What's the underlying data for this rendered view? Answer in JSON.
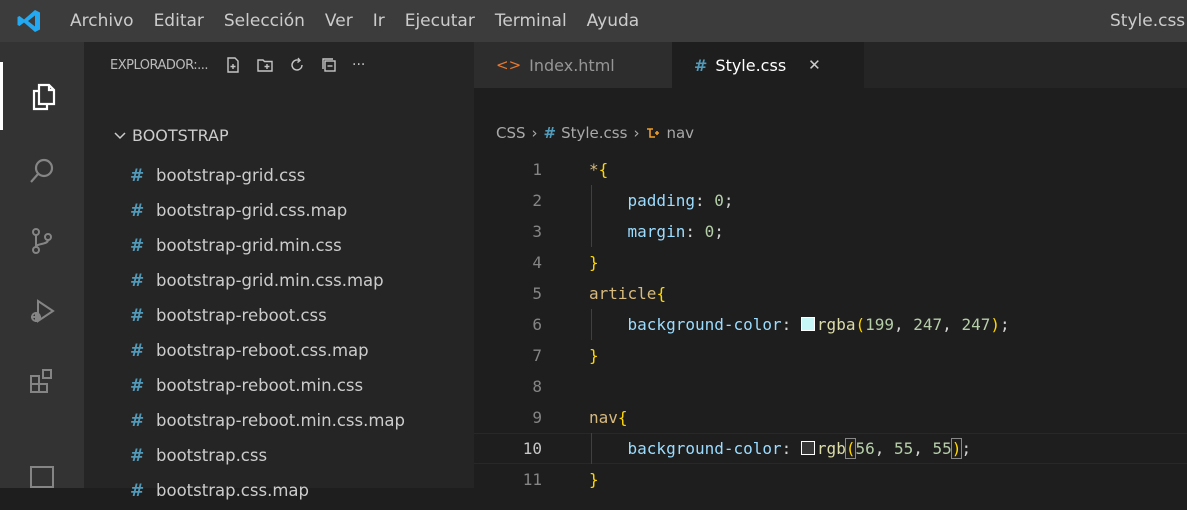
{
  "titlebar": {
    "menu": [
      "Archivo",
      "Editar",
      "Selección",
      "Ver",
      "Ir",
      "Ejecutar",
      "Terminal",
      "Ayuda"
    ],
    "window_title": "Style.css"
  },
  "sidebar": {
    "title": "EXPLORADOR:...",
    "folder": "BOOTSTRAP",
    "files": [
      "bootstrap-grid.css",
      "bootstrap-grid.css.map",
      "bootstrap-grid.min.css",
      "bootstrap-grid.min.css.map",
      "bootstrap-reboot.css",
      "bootstrap-reboot.css.map",
      "bootstrap-reboot.min.css",
      "bootstrap-reboot.min.css.map",
      "bootstrap.css",
      "bootstrap.css.map"
    ]
  },
  "tabs": [
    {
      "label": "Index.html",
      "icon": "html-file-icon",
      "active": false
    },
    {
      "label": "Style.css",
      "icon": "css-hash-icon",
      "active": true
    }
  ],
  "breadcrumb": [
    "CSS",
    "Style.css",
    "nav"
  ],
  "editor": {
    "current_line": 10,
    "lines": [
      {
        "n": "1",
        "tokens": [
          [
            "sel",
            "*"
          ],
          [
            "brace",
            "{"
          ]
        ]
      },
      {
        "n": "2",
        "tokens": [
          [
            "ws",
            "    "
          ],
          [
            "prop",
            "padding"
          ],
          [
            "punc",
            ": "
          ],
          [
            "num",
            "0"
          ],
          [
            "punc",
            ";"
          ]
        ]
      },
      {
        "n": "3",
        "tokens": [
          [
            "ws",
            "    "
          ],
          [
            "prop",
            "margin"
          ],
          [
            "punc",
            ": "
          ],
          [
            "num",
            "0"
          ],
          [
            "punc",
            ";"
          ]
        ]
      },
      {
        "n": "4",
        "tokens": [
          [
            "brace",
            "}"
          ]
        ]
      },
      {
        "n": "5",
        "tokens": [
          [
            "sel",
            "article"
          ],
          [
            "brace",
            "{"
          ]
        ]
      },
      {
        "n": "6",
        "tokens": [
          [
            "ws",
            "    "
          ],
          [
            "prop",
            "background-color"
          ],
          [
            "punc",
            ": "
          ],
          [
            "swatch",
            "#c7f7f7"
          ],
          [
            "fn",
            "rgba"
          ],
          [
            "brace",
            "("
          ],
          [
            "num",
            "199"
          ],
          [
            "punc",
            ", "
          ],
          [
            "num",
            "247"
          ],
          [
            "punc",
            ", "
          ],
          [
            "num",
            "247"
          ],
          [
            "brace",
            ")"
          ],
          [
            "punc",
            ";"
          ]
        ]
      },
      {
        "n": "7",
        "tokens": [
          [
            "brace",
            "}"
          ]
        ]
      },
      {
        "n": "8",
        "tokens": []
      },
      {
        "n": "9",
        "tokens": [
          [
            "sel",
            "nav"
          ],
          [
            "brace",
            "{"
          ]
        ]
      },
      {
        "n": "10",
        "tokens": [
          [
            "ws",
            "    "
          ],
          [
            "prop",
            "background-color"
          ],
          [
            "punc",
            ": "
          ],
          [
            "swatch",
            "#383737"
          ],
          [
            "fn",
            "rgb"
          ],
          [
            "bracketopen",
            "("
          ],
          [
            "num",
            "56"
          ],
          [
            "punc",
            ", "
          ],
          [
            "num",
            "55"
          ],
          [
            "punc",
            ", "
          ],
          [
            "num",
            "55"
          ],
          [
            "bracketclose",
            ")"
          ],
          [
            "punc",
            ";"
          ]
        ]
      },
      {
        "n": "11",
        "tokens": [
          [
            "brace",
            "}"
          ]
        ]
      }
    ]
  },
  "colors": {
    "titlebar_bg": "#3c3c3c",
    "activitybar_bg": "#333333",
    "sidebar_bg": "#252526",
    "editor_bg": "#1e1e1e",
    "accent_blue": "#23a9f2",
    "css_hash": "#519aba"
  }
}
